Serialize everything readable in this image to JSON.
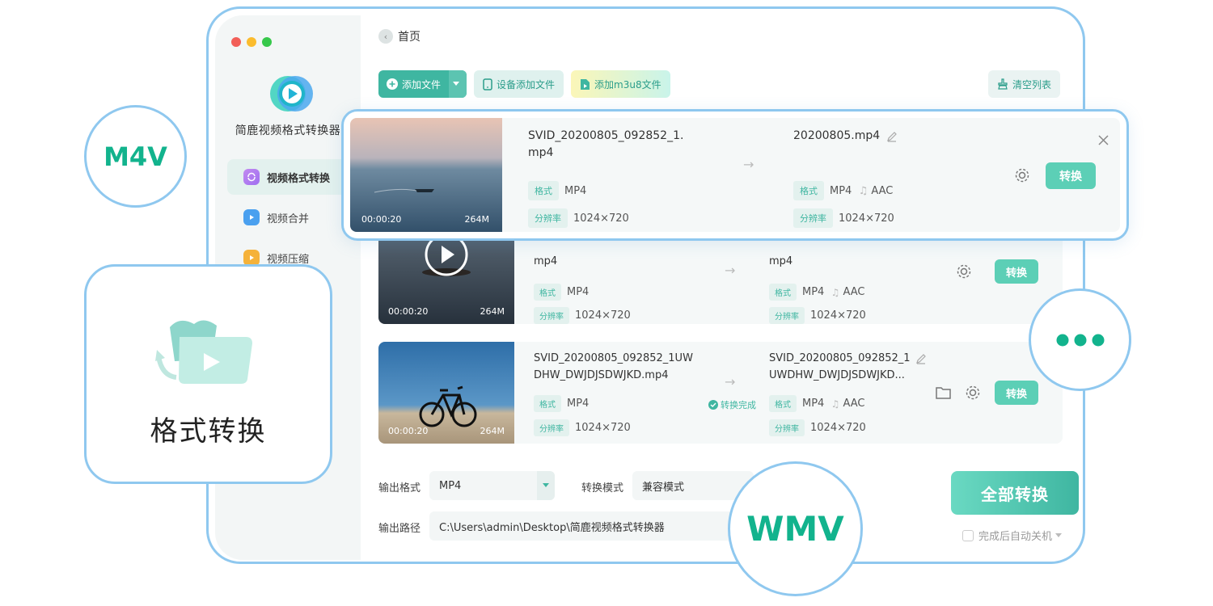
{
  "window": {
    "traffic_colors": [
      "#f25f58",
      "#fbbc2e",
      "#36c84b"
    ],
    "app_name": "简鹿视频格式转换器",
    "accent": "#3fb6a1"
  },
  "sidebar": {
    "items": [
      {
        "label": "视频格式转换",
        "icon": "convert-icon",
        "active": true
      },
      {
        "label": "视频合并",
        "icon": "merge-icon",
        "active": false
      },
      {
        "label": "视频压缩",
        "icon": "compress-icon",
        "active": false
      }
    ]
  },
  "header": {
    "home": "首页"
  },
  "toolbar": {
    "add_file": "添加文件",
    "device_add": "设备添加文件",
    "add_m3u8": "添加m3u8文件",
    "clear_list": "清空列表"
  },
  "labels": {
    "format": "格式",
    "resolution": "分辨率",
    "convert": "转换",
    "done": "转换完成"
  },
  "files": [
    {
      "src_name_1": "SVID_20200805_092852_1.",
      "src_name_2": "mp4",
      "dst_name": "20200805.mp4",
      "src_format": "MP4",
      "dst_format": "MP4",
      "audio": "AAC",
      "resolution": "1024×720",
      "duration": "00:00:20",
      "size": "264M"
    },
    {
      "src_name_2": "mp4",
      "dst_name_2": "mp4",
      "src_format": "MP4",
      "dst_format": "MP4",
      "audio": "AAC",
      "resolution": "1024×720",
      "duration": "00:00:20",
      "size": "264M"
    },
    {
      "src_name_1": "SVID_20200805_092852_1UW",
      "src_name_2": "DHW_DWJDJSDWJKD.mp4",
      "dst_name_1": "SVID_20200805_092852_1",
      "dst_name_2": "UWDHW_DWJDJSDWJKD...",
      "src_format": "MP4",
      "dst_format": "MP4",
      "audio": "AAC",
      "resolution": "1024×720",
      "duration": "00:00:20",
      "size": "264M",
      "status": "转换完成"
    }
  ],
  "bottom": {
    "output_format_label": "输出格式",
    "output_format": "MP4",
    "mode_label": "转换模式",
    "mode": "兼容模式",
    "path_label": "输出路径",
    "path": "C:\\Users\\admin\\Desktop\\简鹿视频格式转换器",
    "convert_all": "全部转换",
    "shutdown": "完成后自动关机"
  },
  "badges": {
    "m4v": "M4V",
    "wmv": "WMV",
    "feature": "格式转换",
    "badge_color": "#12b38d"
  }
}
